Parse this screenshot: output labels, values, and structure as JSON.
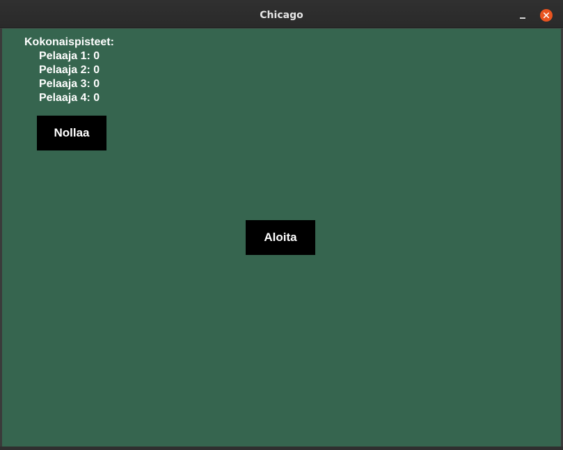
{
  "window": {
    "title": "Chicago"
  },
  "scores": {
    "heading": "Kokonaispisteet:",
    "players": [
      "Pelaaja 1: 0",
      "Pelaaja 2: 0",
      "Pelaaja 3: 0",
      "Pelaaja 4: 0"
    ]
  },
  "buttons": {
    "reset_label": "Nollaa",
    "start_label": "Aloita"
  },
  "icons": {
    "minimize": "minimize-icon",
    "close": "close-icon"
  },
  "colors": {
    "table_background": "#36654f",
    "button_background": "#000000",
    "close_button": "#e95420"
  }
}
